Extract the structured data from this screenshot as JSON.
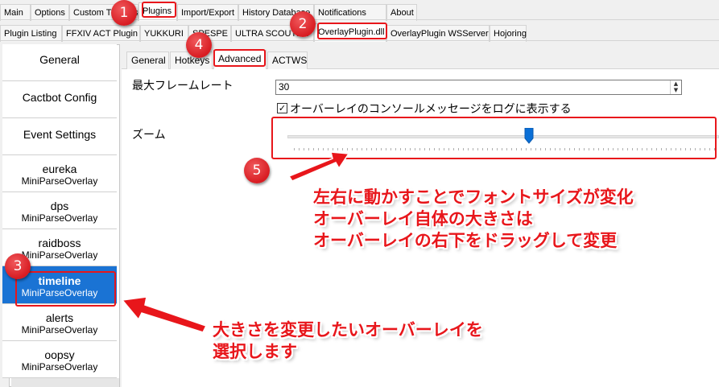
{
  "main_tabs": [
    "Main",
    "Options",
    "Custom Triggers",
    "Plugins",
    "Import/Export",
    "History Database",
    "Notifications",
    "About"
  ],
  "plugin_tabs": [
    "Plugin Listing",
    "FFXIV ACT Plugin",
    "YUKKURI",
    "SPESPE",
    "ULTRA SCOUTER",
    "OverlayPlugin.dll",
    "OverlayPlugin WSServer",
    "Hojoring"
  ],
  "sidebar": {
    "items": [
      {
        "title": "General",
        "subtitle": ""
      },
      {
        "title": "Cactbot Config",
        "subtitle": ""
      },
      {
        "title": "Event Settings",
        "subtitle": ""
      },
      {
        "title": "eureka",
        "subtitle": "MiniParseOverlay"
      },
      {
        "title": "dps",
        "subtitle": "MiniParseOverlay"
      },
      {
        "title": "raidboss",
        "subtitle": "MiniParseOverlay"
      },
      {
        "title": "timeline",
        "subtitle": "MiniParseOverlay"
      },
      {
        "title": "alerts",
        "subtitle": "MiniParseOverlay"
      },
      {
        "title": "oopsy",
        "subtitle": "MiniParseOverlay"
      }
    ],
    "selected": "timeline"
  },
  "sub_tabs": [
    "General",
    "Hotkeys",
    "Advanced",
    "ACTWS"
  ],
  "settings": {
    "fps_label": "最大フレームレート",
    "fps_value": "30",
    "log_checkbox_label": "オーバーレイのコンソールメッセージをログに表示する",
    "log_checkbox_checked": true,
    "zoom_label": "ズーム",
    "zoom_level": 0.56
  },
  "annotations": {
    "badges": [
      "1",
      "2",
      "3",
      "4",
      "5"
    ],
    "callout5": [
      "左右に動かすことでフォントサイズが変化",
      "オーバーレイ自体の大きさは",
      "オーバーレイの右下をドラッグして変更"
    ],
    "callout3": [
      "大きさを変更したいオーバーレイを",
      "選択します"
    ],
    "accent_color": "#e8161b",
    "selection_color": "#1a73d4"
  }
}
